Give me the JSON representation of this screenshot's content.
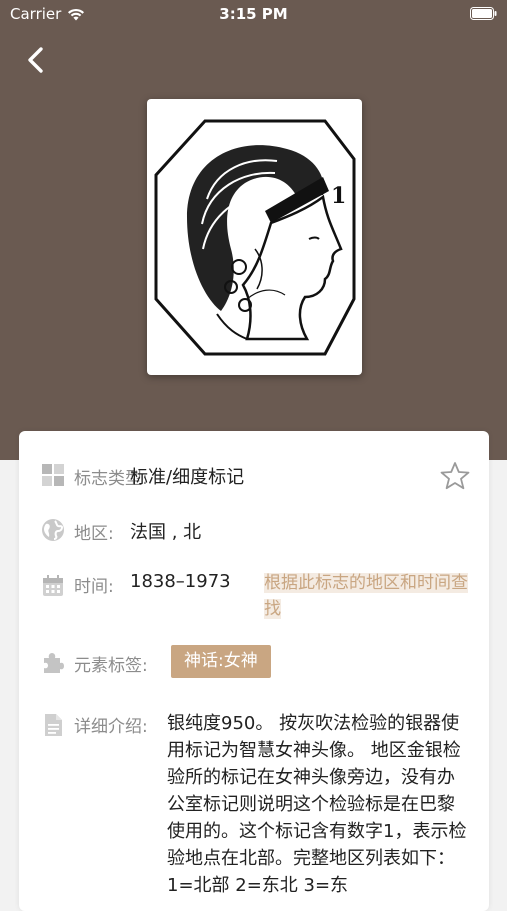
{
  "status_bar": {
    "carrier": "Carrier",
    "time": "3:15 PM"
  },
  "mark": {
    "image_alt": "智慧女神头像标记"
  },
  "details": {
    "type": {
      "label": "标志类型:",
      "value": "标准/细度标记"
    },
    "region": {
      "label": "地区:",
      "value": "法国 , 北"
    },
    "time": {
      "label": "时间:",
      "value": "1838–1973",
      "search_link": "根据此标志的地区和时间查找"
    },
    "tags": {
      "label": "元素标签:",
      "items": [
        "神话:女神"
      ]
    },
    "description": {
      "label": "详细介绍:",
      "text": "银纯度950。 按灰吹法检验的银器使用标记为智慧女神头像。 地区金银检验所的标记在女神头像旁边，没有办公室标记则说明这个检验标是在巴黎使用的。这个标记含有数字1，表示检验地点在北部。完整地区列表如下：1=北部 2=东北 3=东"
    }
  },
  "colors": {
    "header": "#6a5a51",
    "accent": "#c9a682",
    "label": "#8c8c8c"
  },
  "icons": [
    "back-chevron-icon",
    "star-outline-icon",
    "grid-icon",
    "globe-icon",
    "calendar-icon",
    "puzzle-icon",
    "document-icon"
  ]
}
